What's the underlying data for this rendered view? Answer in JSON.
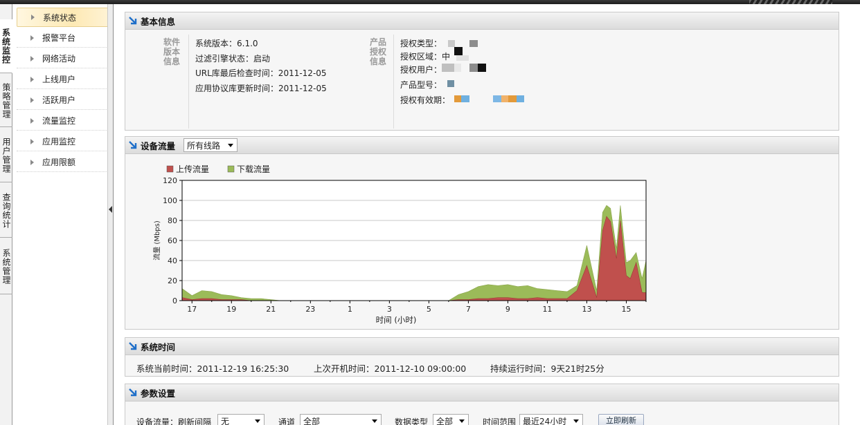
{
  "colors": {
    "upload": "#c0504d",
    "download": "#9bbb59",
    "accent": "#1f6fc9",
    "active_nav": "#fde9b4"
  },
  "vertical_tabs": [
    {
      "label": "系统监控",
      "active": true
    },
    {
      "label": "策略管理",
      "active": false
    },
    {
      "label": "用户管理",
      "active": false
    },
    {
      "label": "查询统计",
      "active": false
    },
    {
      "label": "系统管理",
      "active": false
    }
  ],
  "sidebar": {
    "items": [
      {
        "label": "系统状态",
        "active": true
      },
      {
        "label": "报警平台",
        "active": false
      },
      {
        "label": "网络活动",
        "active": false
      },
      {
        "label": "上线用户",
        "active": false
      },
      {
        "label": "活跃用户",
        "active": false
      },
      {
        "label": "流量监控",
        "active": false
      },
      {
        "label": "应用监控",
        "active": false
      },
      {
        "label": "应用限额",
        "active": false
      }
    ]
  },
  "basic_info": {
    "title": "基本信息",
    "software_label": "软件版本信息",
    "software": [
      "系统版本：6.1.0",
      "过滤引擎状态：启动",
      "URL库最后检查时间：2011-12-05",
      "应用协议库更新时间：2011-12-05"
    ],
    "product_label": "产品授权信息",
    "product": [
      "授权类型：",
      "授权区域：中",
      "授权用户：",
      "产品型号：",
      "授权有效期："
    ]
  },
  "traffic": {
    "title": "设备流量",
    "line_select": "所有线路"
  },
  "chart_data": {
    "type": "area",
    "legend": [
      {
        "name": "上传流量",
        "color": "#c0504d"
      },
      {
        "name": "下载流量",
        "color": "#9bbb59"
      }
    ],
    "legend_position": "top-left",
    "xlabel": "时间 (小时)",
    "ylabel": "流量 (Mbps)",
    "ylim": [
      0,
      120
    ],
    "yticks": [
      0,
      20,
      40,
      60,
      80,
      100,
      120
    ],
    "xticks": [
      "17",
      "19",
      "21",
      "23",
      "1",
      "3",
      "5",
      "7",
      "9",
      "11",
      "13",
      "15"
    ],
    "grid": true,
    "x": [
      16.5,
      17,
      17.5,
      18,
      18.5,
      19,
      19.5,
      20,
      20.5,
      21,
      21.5,
      22,
      22.5,
      23,
      23.5,
      24,
      24.5,
      25,
      25.5,
      26,
      26.5,
      27,
      27.5,
      28,
      28.5,
      29,
      29.5,
      30,
      30.5,
      31,
      31.5,
      32,
      32.5,
      33,
      33.5,
      34,
      34.5,
      35,
      35.5,
      36,
      36.5,
      37,
      37.5,
      37.8,
      38,
      38.2,
      38.5,
      38.7,
      39,
      39.2,
      39.5,
      39.8,
      40
    ],
    "series": [
      {
        "name": "上传流量",
        "values": [
          3,
          1,
          2,
          2,
          1,
          1,
          1,
          0,
          0,
          0,
          0,
          0,
          0,
          0,
          0,
          0,
          0,
          0,
          0,
          0,
          0,
          0,
          0,
          0,
          0,
          0,
          0,
          0,
          1,
          1,
          2,
          2,
          3,
          3,
          2,
          2,
          3,
          2,
          2,
          2,
          10,
          35,
          3,
          70,
          84,
          79,
          42,
          80,
          25,
          22,
          38,
          8,
          8
        ]
      },
      {
        "name": "下载流量",
        "values": [
          12,
          5,
          10,
          9,
          6,
          5,
          3,
          2,
          2,
          1,
          0,
          0,
          0,
          0,
          0,
          0,
          0,
          0,
          0,
          0,
          0,
          0,
          0,
          0,
          0,
          0,
          0,
          0,
          6,
          9,
          14,
          16,
          15,
          16,
          14,
          15,
          12,
          11,
          10,
          9,
          15,
          55,
          10,
          88,
          95,
          92,
          52,
          95,
          38,
          40,
          48,
          22,
          40
        ]
      }
    ]
  },
  "system_time": {
    "title": "系统时间",
    "current": "系统当前时间：2011-12-19 16:25:30",
    "boot": "上次开机时间：2011-12-10 09:00:00",
    "uptime": "持续运行时间：9天21时25分"
  },
  "params": {
    "title": "参数设置",
    "traffic_label": "设备流量：刷新间隔",
    "interval_value": "无",
    "channel_label": "通道",
    "channel_value": "全部",
    "datatype_label": "数据类型",
    "datatype_value": "全部",
    "range_label": "时间范围",
    "range_value": "最近24小时",
    "refresh_button": "立即刷新"
  }
}
